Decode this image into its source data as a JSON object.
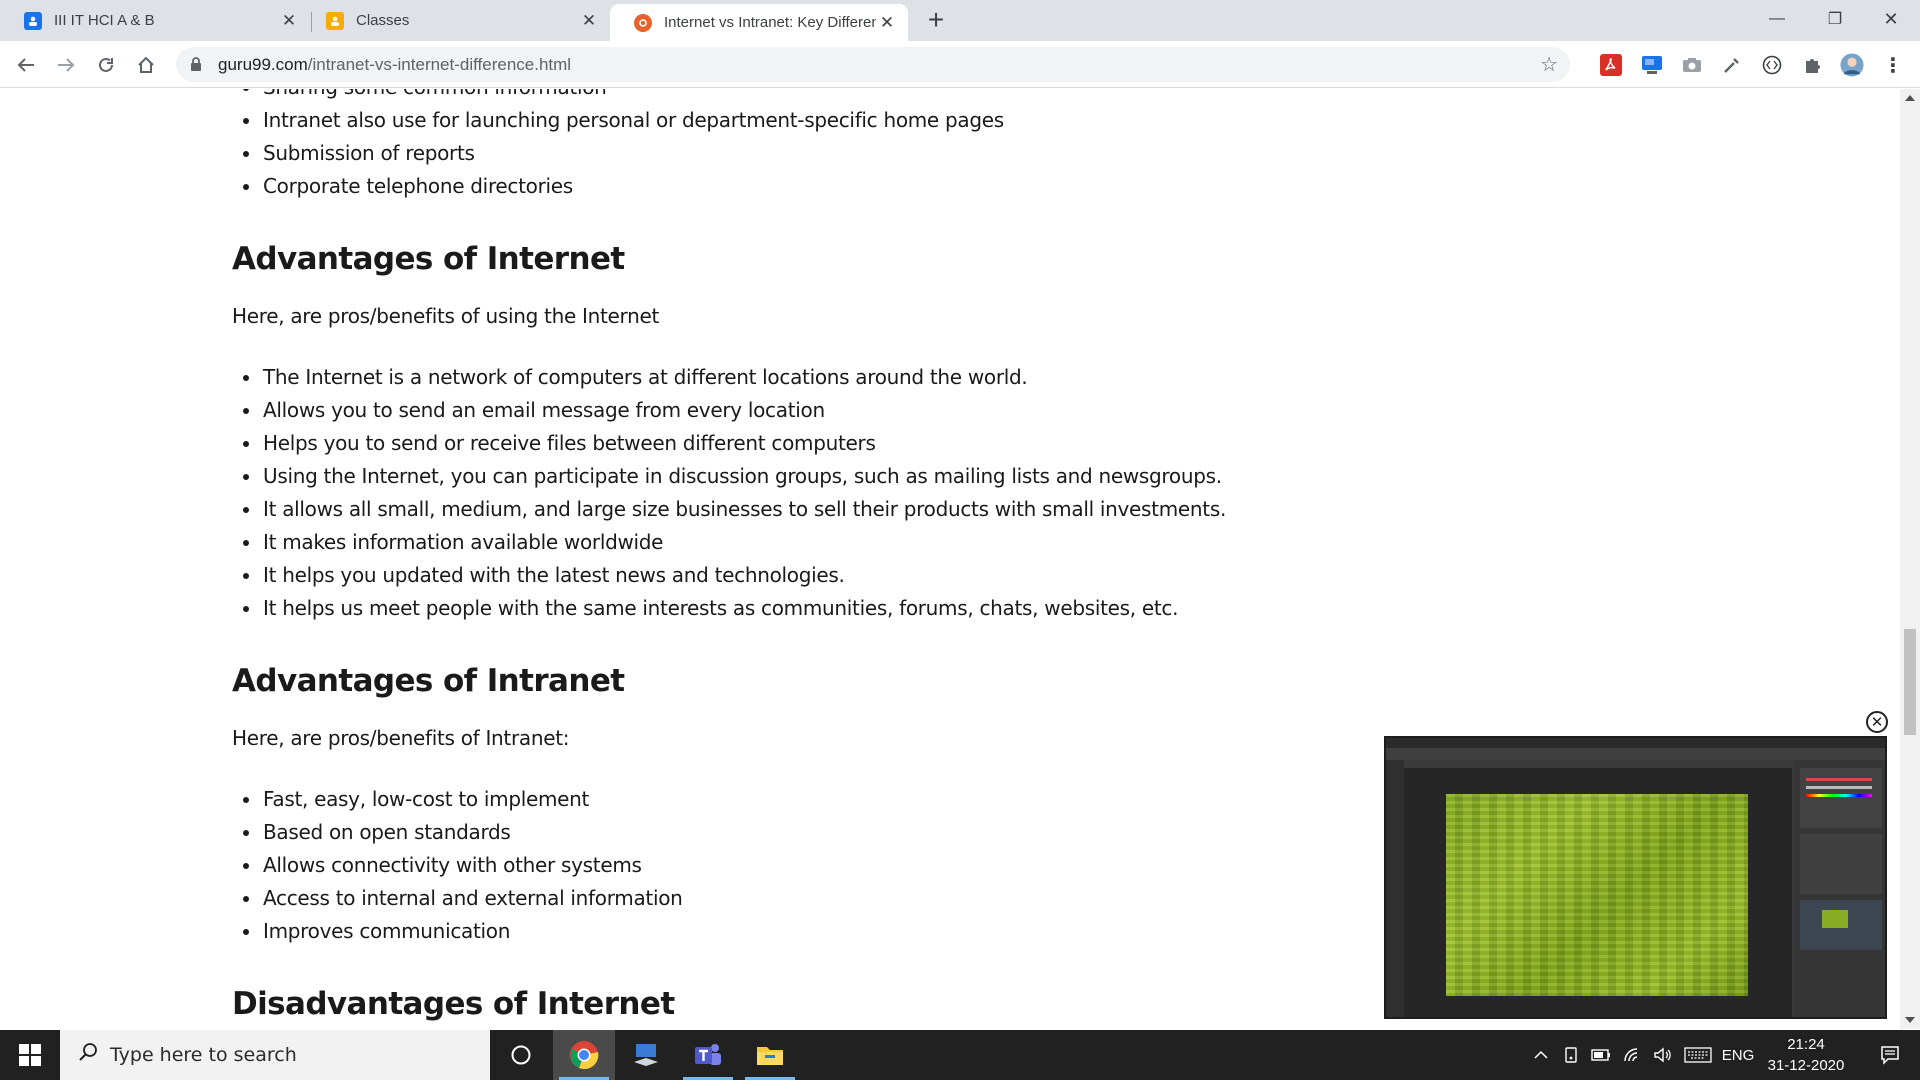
{
  "browser": {
    "tabs": [
      {
        "title": "III IT HCI A & B",
        "close": "✕",
        "favicon": "classroom-blue-icon",
        "color": "#1a73e8"
      },
      {
        "title": "Classes",
        "close": "✕",
        "favicon": "classroom-yellow-icon",
        "color": "#f9ab00"
      },
      {
        "title": "Internet vs Intranet: Key Differenc",
        "close": "✕",
        "favicon": "guru99-icon",
        "color": "#e8622c"
      }
    ],
    "new_tab": "+",
    "window_controls": {
      "minimize": "—",
      "restore": "❐",
      "close": "✕"
    },
    "url_host": "guru99.com",
    "url_path": "/intranet-vs-internet-difference.html"
  },
  "article": {
    "intro_items": [
      "Sharing some common information",
      "Intranet also use for launching personal or department-specific home pages",
      "Submission of reports",
      "Corporate telephone directories"
    ],
    "sections": [
      {
        "heading": "Advantages of Internet",
        "intro": "Here, are pros/benefits of using the Internet",
        "items": [
          "The Internet is a network of computers at different locations around the world.",
          "Allows you to send an email message from every location",
          "Helps you to send or receive files between different computers",
          "Using the Internet, you can participate in discussion groups, such as mailing lists and newsgroups.",
          "It allows all small, medium, and large size businesses to sell their products with small investments.",
          "It makes information available worldwide",
          "It helps you updated with the latest news and technologies.",
          "It helps us meet people with the same interests as communities, forums, chats, websites, etc."
        ]
      },
      {
        "heading": "Advantages of Intranet",
        "intro": "Here, are pros/benefits of Intranet:",
        "items": [
          "Fast, easy, low-cost to implement",
          "Based on open standards",
          "Allows connectivity with other systems",
          "Access to internal and external information",
          "Improves communication"
        ]
      },
      {
        "heading": "Disadvantages of Internet"
      }
    ]
  },
  "video": {
    "close": "✕"
  },
  "taskbar": {
    "search_placeholder": "Type here to search",
    "language": "ENG",
    "time": "21:24",
    "date": "31-12-2020"
  }
}
